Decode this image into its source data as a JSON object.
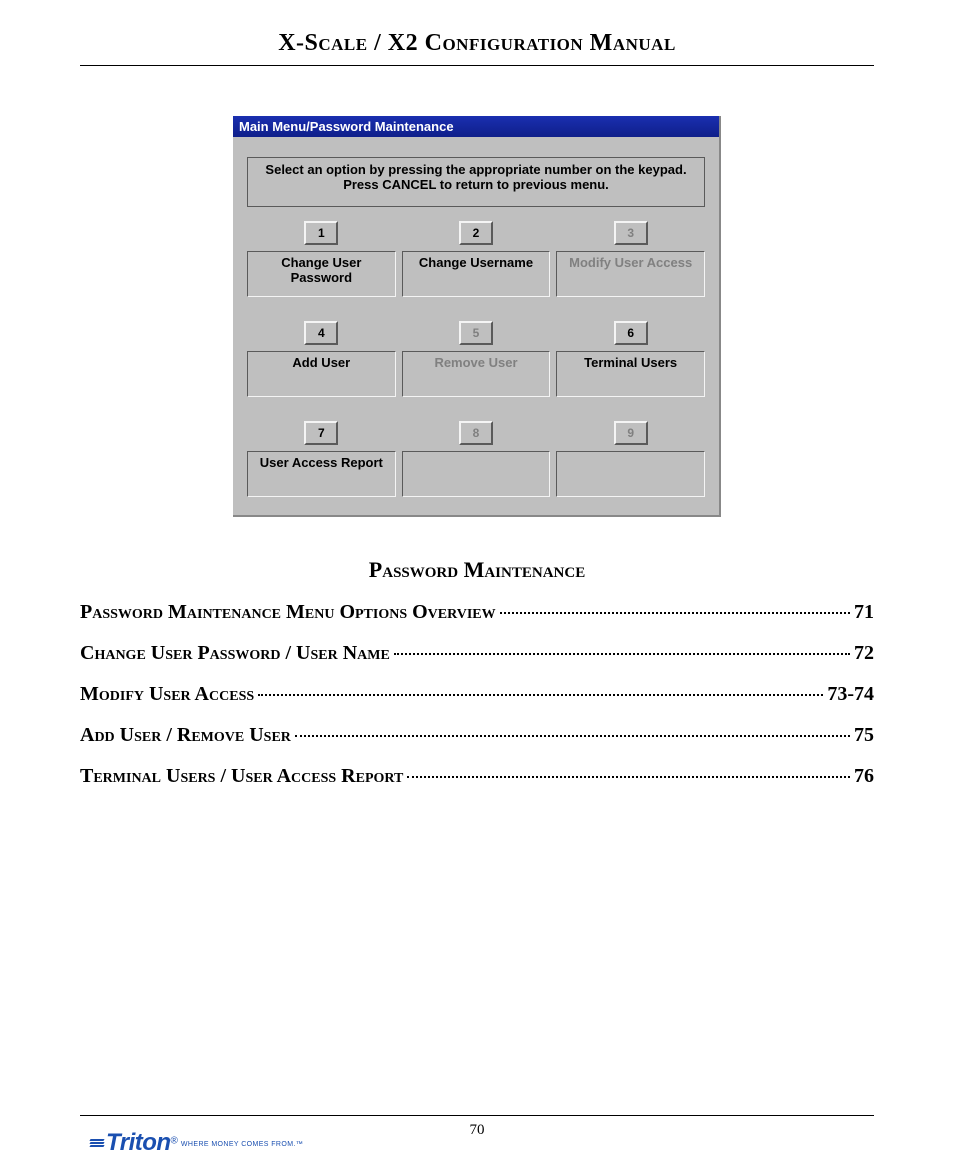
{
  "header": {
    "title": "X-Scale / X2 Configuration Manual"
  },
  "screenshot": {
    "titlebar": "Main Menu/Password Maintenance",
    "instruction_line1": "Select an option by pressing the appropriate number on the keypad.",
    "instruction_line2": "Press CANCEL to return to previous menu.",
    "options": [
      {
        "num": "1",
        "label": "Change User Password",
        "enabled": true
      },
      {
        "num": "2",
        "label": "Change Username",
        "enabled": true
      },
      {
        "num": "3",
        "label": "Modify User Access",
        "enabled": false
      },
      {
        "num": "4",
        "label": "Add User",
        "enabled": true
      },
      {
        "num": "5",
        "label": "Remove User",
        "enabled": false
      },
      {
        "num": "6",
        "label": "Terminal Users",
        "enabled": true
      },
      {
        "num": "7",
        "label": "User Access Report",
        "enabled": true
      },
      {
        "num": "8",
        "label": "",
        "enabled": false
      },
      {
        "num": "9",
        "label": "",
        "enabled": false
      }
    ]
  },
  "section": {
    "heading": "Password Maintenance"
  },
  "toc": [
    {
      "label": "Password Maintenance Menu Options Overview",
      "page": "71"
    },
    {
      "label": "Change User Password / User Name",
      "page": "72"
    },
    {
      "label": "Modify User Access",
      "page": "73-74"
    },
    {
      "label": "Add User / Remove User",
      "page": "75"
    },
    {
      "label": "Terminal Users / User Access Report",
      "page": "76"
    }
  ],
  "footer": {
    "page_number": "70",
    "brand_name": "Triton",
    "brand_reg": "®",
    "brand_tagline": "WHERE MONEY COMES FROM.™"
  }
}
